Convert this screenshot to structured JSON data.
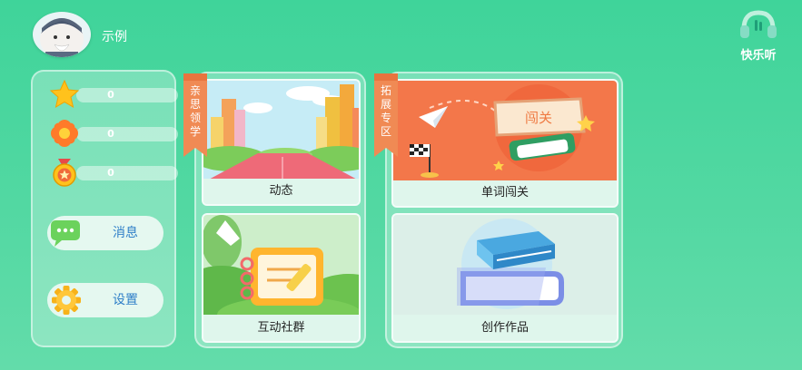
{
  "header": {
    "username": "示例",
    "listen_label": "快乐听"
  },
  "stats": [
    {
      "icon": "star-icon",
      "value": "0"
    },
    {
      "icon": "flower-icon",
      "value": "0"
    },
    {
      "icon": "medal-icon",
      "value": "0"
    }
  ],
  "sidebar": {
    "messages_label": "消息",
    "settings_label": "设置"
  },
  "panel1": {
    "ribbon": [
      "亲",
      "思",
      "领",
      "学"
    ],
    "cards": [
      {
        "label": "动态"
      },
      {
        "label": "互动社群"
      }
    ]
  },
  "panel2": {
    "ribbon": [
      "拓",
      "展",
      "专",
      "区"
    ],
    "cards": [
      {
        "label": "单词闯关",
        "sign": "闯关"
      },
      {
        "label": "创作作品"
      }
    ]
  },
  "colors": {
    "background": "#4fd6a0",
    "ribbon": "#f08a54",
    "button_text": "#2f7fc8",
    "word_card_bg": "#f3774a"
  }
}
